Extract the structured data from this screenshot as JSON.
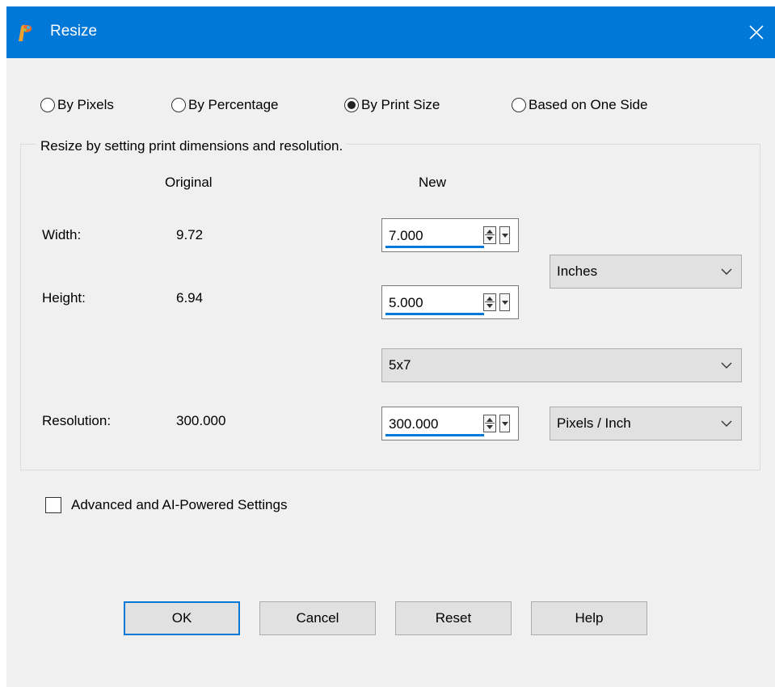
{
  "window": {
    "title": "Resize",
    "close_glyph": "✕",
    "app_icon": "paintshop-pro-icon",
    "accent_color": "#0078d7"
  },
  "modes": {
    "by_pixels": "By Pixels",
    "by_percentage": "By Percentage",
    "by_print_size": "By Print Size",
    "based_on_one_side": "Based on One Side",
    "selected": "by_print_size"
  },
  "group": {
    "legend": "Resize by setting print dimensions and resolution.",
    "header_original": "Original",
    "header_new": "New",
    "width": {
      "label": "Width:",
      "original": "9.72",
      "new": "7.000"
    },
    "height": {
      "label": "Height:",
      "original": "6.94",
      "new": "5.000"
    },
    "units": "Inches",
    "preset": "5x7",
    "resolution": {
      "label": "Resolution:",
      "original": "300.000",
      "new": "300.000",
      "units": "Pixels / Inch"
    }
  },
  "advanced": {
    "label": "Advanced and AI-Powered Settings",
    "checked": false
  },
  "buttons": {
    "ok": "OK",
    "cancel": "Cancel",
    "reset": "Reset",
    "help": "Help"
  }
}
